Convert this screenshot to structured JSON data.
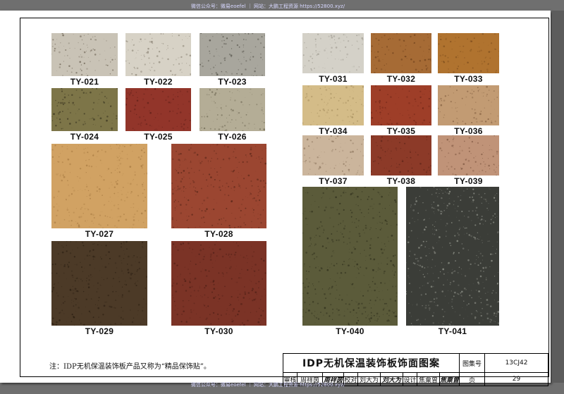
{
  "watermark": {
    "top": "微信公众号：微易eoefel ｜ 网站：大鹏工程资源 https://52800.xyz/",
    "bottom": "微信公众号：微易eoefel ｜ 网站：大鹏工程资源 https://52800.xyz/"
  },
  "swatches": [
    {
      "code": "TY-021",
      "color": "#c9c3b6",
      "speck": "#6b6152"
    },
    {
      "code": "TY-022",
      "color": "#d7d2c6",
      "speck": "#8a8274"
    },
    {
      "code": "TY-023",
      "color": "#a8a69d",
      "speck": "#4b4940"
    },
    {
      "code": "TY-024",
      "color": "#7d7548",
      "speck": "#3b3620"
    },
    {
      "code": "TY-025",
      "color": "#92352a",
      "speck": "#5f1f18"
    },
    {
      "code": "TY-026",
      "color": "#b4ad96",
      "speck": "#6b6550"
    },
    {
      "code": "TY-027",
      "color": "#d1a263",
      "speck": "#a77a42"
    },
    {
      "code": "TY-028",
      "color": "#9b4631",
      "speck": "#5a2719"
    },
    {
      "code": "TY-029",
      "color": "#4c3a27",
      "speck": "#2a1e12"
    },
    {
      "code": "TY-030",
      "color": "#7b3326",
      "speck": "#4e1f16"
    },
    {
      "code": "TY-031",
      "color": "#d4d1c8",
      "speck": "#9e9a90"
    },
    {
      "code": "TY-032",
      "color": "#a66b35",
      "speck": "#6e411c"
    },
    {
      "code": "TY-033",
      "color": "#b0732f",
      "speck": "#7a4b1c"
    },
    {
      "code": "TY-034",
      "color": "#d4bc88",
      "speck": "#a68e5e"
    },
    {
      "code": "TY-035",
      "color": "#9e3e28",
      "speck": "#6b2417"
    },
    {
      "code": "TY-036",
      "color": "#c29b73",
      "speck": "#7d5a3c"
    },
    {
      "code": "TY-037",
      "color": "#cbb59c",
      "speck": "#8f7760"
    },
    {
      "code": "TY-038",
      "color": "#8c3a28",
      "speck": "#5c2418"
    },
    {
      "code": "TY-039",
      "color": "#c09378",
      "speck": "#7d5640"
    },
    {
      "code": "TY-040",
      "color": "#5b5b3a",
      "speck": "#2f2f1c"
    },
    {
      "code": "TY-041",
      "color": "#3b3d38",
      "speck": "#9a9c93"
    }
  ],
  "note": "注：IDP无机保温装饰板产品又称为“精品保饰贴”。",
  "titleblock": {
    "title": "IDP无机保温装饰板饰面图案",
    "atlas_label": "图集号",
    "atlas_no": "13CJ42",
    "review_label": "审核",
    "reviewer": "周祥茵",
    "reviewer_sig": "周祥茵",
    "check_label": "校对",
    "checker": "刘大为",
    "checker_sig": "刘大为",
    "design_label": "设计",
    "designer": "焦粟曾",
    "designer_sig": "焦粟曾",
    "page_label": "页",
    "page_no": "29"
  }
}
